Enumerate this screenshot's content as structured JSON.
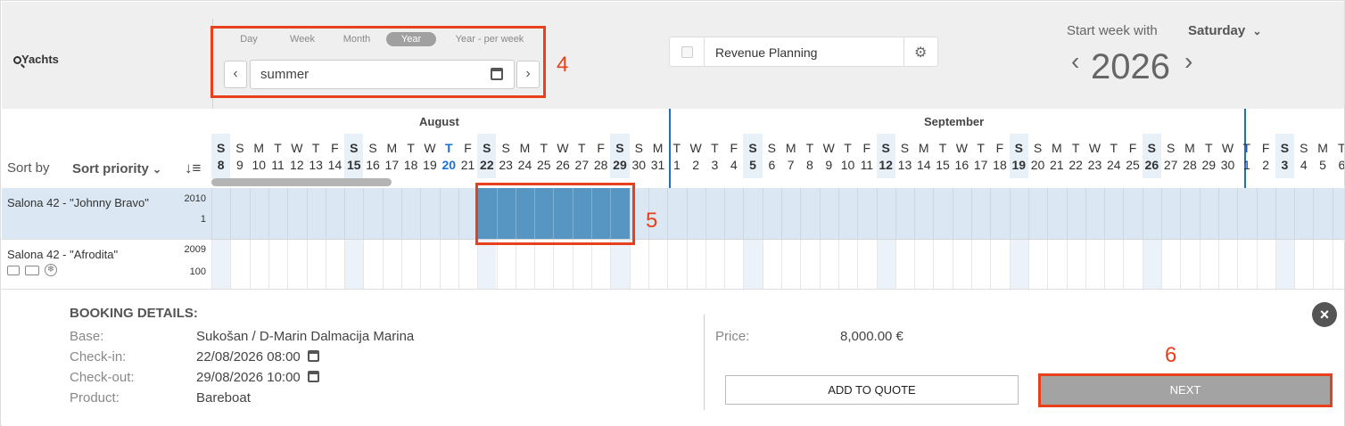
{
  "left_panel": {
    "search_label": "Yachts",
    "sort_by_label": "Sort by",
    "sort_value": "Sort priority"
  },
  "view_tabs": [
    "Day",
    "Week",
    "Month",
    "Year",
    "Year - per week"
  ],
  "active_tab": "Year",
  "period": {
    "value": "summer"
  },
  "revenue": {
    "label": "Revenue Planning"
  },
  "week_start": {
    "label": "Start week with",
    "value": "Saturday"
  },
  "year": "2026",
  "months": [
    "August",
    "September"
  ],
  "days": [
    {
      "l": "S",
      "n": "8"
    },
    {
      "l": "S",
      "n": "9"
    },
    {
      "l": "M",
      "n": "10"
    },
    {
      "l": "T",
      "n": "11"
    },
    {
      "l": "W",
      "n": "12"
    },
    {
      "l": "T",
      "n": "13"
    },
    {
      "l": "F",
      "n": "14"
    },
    {
      "l": "S",
      "n": "15"
    },
    {
      "l": "S",
      "n": "16"
    },
    {
      "l": "M",
      "n": "17"
    },
    {
      "l": "T",
      "n": "18"
    },
    {
      "l": "W",
      "n": "19"
    },
    {
      "l": "T",
      "n": "20"
    },
    {
      "l": "F",
      "n": "21"
    },
    {
      "l": "S",
      "n": "22"
    },
    {
      "l": "S",
      "n": "23"
    },
    {
      "l": "M",
      "n": "24"
    },
    {
      "l": "T",
      "n": "25"
    },
    {
      "l": "W",
      "n": "26"
    },
    {
      "l": "T",
      "n": "27"
    },
    {
      "l": "F",
      "n": "28"
    },
    {
      "l": "S",
      "n": "29"
    },
    {
      "l": "S",
      "n": "30"
    },
    {
      "l": "M",
      "n": "31"
    },
    {
      "l": "T",
      "n": "1"
    },
    {
      "l": "W",
      "n": "2"
    },
    {
      "l": "T",
      "n": "3"
    },
    {
      "l": "F",
      "n": "4"
    },
    {
      "l": "S",
      "n": "5"
    },
    {
      "l": "S",
      "n": "6"
    },
    {
      "l": "M",
      "n": "7"
    },
    {
      "l": "T",
      "n": "8"
    },
    {
      "l": "W",
      "n": "9"
    },
    {
      "l": "T",
      "n": "10"
    },
    {
      "l": "F",
      "n": "11"
    },
    {
      "l": "S",
      "n": "12"
    },
    {
      "l": "S",
      "n": "13"
    },
    {
      "l": "M",
      "n": "14"
    },
    {
      "l": "T",
      "n": "15"
    },
    {
      "l": "W",
      "n": "16"
    },
    {
      "l": "T",
      "n": "17"
    },
    {
      "l": "F",
      "n": "18"
    },
    {
      "l": "S",
      "n": "19"
    },
    {
      "l": "S",
      "n": "20"
    },
    {
      "l": "M",
      "n": "21"
    },
    {
      "l": "T",
      "n": "22"
    },
    {
      "l": "W",
      "n": "23"
    },
    {
      "l": "T",
      "n": "24"
    },
    {
      "l": "F",
      "n": "25"
    },
    {
      "l": "S",
      "n": "26"
    },
    {
      "l": "S",
      "n": "27"
    },
    {
      "l": "M",
      "n": "28"
    },
    {
      "l": "T",
      "n": "29"
    },
    {
      "l": "W",
      "n": "30"
    },
    {
      "l": "T",
      "n": "1"
    },
    {
      "l": "F",
      "n": "2"
    },
    {
      "l": "S",
      "n": "3"
    },
    {
      "l": "S",
      "n": "4"
    },
    {
      "l": "M",
      "n": "5"
    },
    {
      "l": "T",
      "n": "6"
    }
  ],
  "today_index": 12,
  "yachts": [
    {
      "name": "Salona 42 - \"Johnny Bravo\"",
      "year": "2010",
      "priority": "1"
    },
    {
      "name": "Salona 42 - \"Afrodita\"",
      "year": "2009",
      "priority": "100"
    }
  ],
  "booking": {
    "title": "BOOKING DETAILS:",
    "base_label": "Base:",
    "base": "Sukošan / D-Marin Dalmacija Marina",
    "checkin_label": "Check-in:",
    "checkin": "22/08/2026 08:00",
    "checkout_label": "Check-out:",
    "checkout": "29/08/2026 10:00",
    "product_label": "Product:",
    "product": "Bareboat",
    "price_label": "Price:",
    "price": "8,000.00 €",
    "add_quote": "ADD TO QUOTE",
    "next": "NEXT"
  },
  "annotations": [
    "4",
    "5",
    "6"
  ],
  "colors": {
    "accent": "#1a6fd0",
    "selection": "#5796c2",
    "highlight_row": "#dbe7f2",
    "red": "#e8401c"
  }
}
